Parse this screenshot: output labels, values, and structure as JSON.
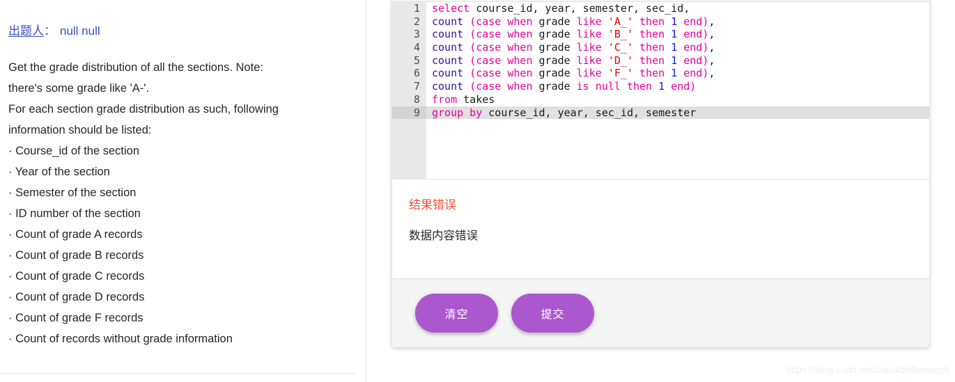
{
  "problem": {
    "author_label": "出题人",
    "author_colon": "：",
    "author_name": "null null",
    "description_lines": [
      "Get the grade distribution of all the sections. Note:",
      "there's some grade like 'A-'.",
      "For each section grade distribution as such, following",
      "information should be listed:"
    ],
    "requirements": [
      "· Course_id of the section",
      "· Year of the section",
      "· Semester of the section",
      "· ID number of the section",
      "· Count of grade A records",
      "· Count of grade B records",
      "· Count of grade C records",
      "· Count of grade D records",
      "· Count of grade F records",
      "· Count of records without grade information"
    ]
  },
  "editor": {
    "active_line": 9,
    "line_numbers": [
      "1",
      "2",
      "3",
      "4",
      "5",
      "6",
      "7",
      "8",
      "9"
    ],
    "lines": [
      [
        {
          "t": "select",
          "c": "kw"
        },
        {
          "t": " course_id, year, semester, sec_id,",
          "c": "pl"
        }
      ],
      [
        {
          "t": "count ",
          "c": "fn"
        },
        {
          "t": "(",
          "c": "kw"
        },
        {
          "t": "case when",
          "c": "kw"
        },
        {
          "t": " grade ",
          "c": "pl"
        },
        {
          "t": "like",
          "c": "kw"
        },
        {
          "t": " ",
          "c": "pl"
        },
        {
          "t": "'A_'",
          "c": "str"
        },
        {
          "t": " ",
          "c": "pl"
        },
        {
          "t": "then",
          "c": "kw"
        },
        {
          "t": " ",
          "c": "pl"
        },
        {
          "t": "1",
          "c": "num"
        },
        {
          "t": " ",
          "c": "pl"
        },
        {
          "t": "end",
          "c": "kw"
        },
        {
          "t": ")",
          "c": "kw"
        },
        {
          "t": ",",
          "c": "pl"
        }
      ],
      [
        {
          "t": "count ",
          "c": "fn"
        },
        {
          "t": "(",
          "c": "kw"
        },
        {
          "t": "case when",
          "c": "kw"
        },
        {
          "t": " grade ",
          "c": "pl"
        },
        {
          "t": "like",
          "c": "kw"
        },
        {
          "t": " ",
          "c": "pl"
        },
        {
          "t": "'B_'",
          "c": "str"
        },
        {
          "t": " ",
          "c": "pl"
        },
        {
          "t": "then",
          "c": "kw"
        },
        {
          "t": " ",
          "c": "pl"
        },
        {
          "t": "1",
          "c": "num"
        },
        {
          "t": " ",
          "c": "pl"
        },
        {
          "t": "end",
          "c": "kw"
        },
        {
          "t": ")",
          "c": "kw"
        },
        {
          "t": ",",
          "c": "pl"
        }
      ],
      [
        {
          "t": "count ",
          "c": "fn"
        },
        {
          "t": "(",
          "c": "kw"
        },
        {
          "t": "case when",
          "c": "kw"
        },
        {
          "t": " grade ",
          "c": "pl"
        },
        {
          "t": "like",
          "c": "kw"
        },
        {
          "t": " ",
          "c": "pl"
        },
        {
          "t": "'C_'",
          "c": "str"
        },
        {
          "t": " ",
          "c": "pl"
        },
        {
          "t": "then",
          "c": "kw"
        },
        {
          "t": " ",
          "c": "pl"
        },
        {
          "t": "1",
          "c": "num"
        },
        {
          "t": " ",
          "c": "pl"
        },
        {
          "t": "end",
          "c": "kw"
        },
        {
          "t": ")",
          "c": "kw"
        },
        {
          "t": ",",
          "c": "pl"
        }
      ],
      [
        {
          "t": "count ",
          "c": "fn"
        },
        {
          "t": "(",
          "c": "kw"
        },
        {
          "t": "case when",
          "c": "kw"
        },
        {
          "t": " grade ",
          "c": "pl"
        },
        {
          "t": "like",
          "c": "kw"
        },
        {
          "t": " ",
          "c": "pl"
        },
        {
          "t": "'D_'",
          "c": "str"
        },
        {
          "t": " ",
          "c": "pl"
        },
        {
          "t": "then",
          "c": "kw"
        },
        {
          "t": " ",
          "c": "pl"
        },
        {
          "t": "1",
          "c": "num"
        },
        {
          "t": " ",
          "c": "pl"
        },
        {
          "t": "end",
          "c": "kw"
        },
        {
          "t": ")",
          "c": "kw"
        },
        {
          "t": ",",
          "c": "pl"
        }
      ],
      [
        {
          "t": "count ",
          "c": "fn"
        },
        {
          "t": "(",
          "c": "kw"
        },
        {
          "t": "case when",
          "c": "kw"
        },
        {
          "t": " grade ",
          "c": "pl"
        },
        {
          "t": "like",
          "c": "kw"
        },
        {
          "t": " ",
          "c": "pl"
        },
        {
          "t": "'F_'",
          "c": "str"
        },
        {
          "t": " ",
          "c": "pl"
        },
        {
          "t": "then",
          "c": "kw"
        },
        {
          "t": " ",
          "c": "pl"
        },
        {
          "t": "1",
          "c": "num"
        },
        {
          "t": " ",
          "c": "pl"
        },
        {
          "t": "end",
          "c": "kw"
        },
        {
          "t": ")",
          "c": "kw"
        },
        {
          "t": ",",
          "c": "pl"
        }
      ],
      [
        {
          "t": "count ",
          "c": "fn"
        },
        {
          "t": "(",
          "c": "kw"
        },
        {
          "t": "case when",
          "c": "kw"
        },
        {
          "t": " grade ",
          "c": "pl"
        },
        {
          "t": "is null",
          "c": "kw"
        },
        {
          "t": " ",
          "c": "pl"
        },
        {
          "t": "then",
          "c": "kw"
        },
        {
          "t": " ",
          "c": "pl"
        },
        {
          "t": "1",
          "c": "num"
        },
        {
          "t": " ",
          "c": "pl"
        },
        {
          "t": "end",
          "c": "kw"
        },
        {
          "t": ")",
          "c": "kw"
        }
      ],
      [
        {
          "t": "from",
          "c": "kw"
        },
        {
          "t": " takes",
          "c": "pl"
        }
      ],
      [
        {
          "t": "group by",
          "c": "kw"
        },
        {
          "t": " course_id, year, sec_id, semester",
          "c": "pl"
        }
      ]
    ],
    "code_plain": "select course_id, year, semester, sec_id,\ncount (case when grade like 'A_' then 1 end),\ncount (case when grade like 'B_' then 1 end),\ncount (case when grade like 'C_' then 1 end),\ncount (case when grade like 'D_' then 1 end),\ncount (case when grade like 'F_' then 1 end),\ncount (case when grade is null then 1 end)\nfrom takes\ngroup by course_id, year, sec_id, semester"
  },
  "result": {
    "title": "结果错误",
    "message": "数据内容错误",
    "title_color": "#f4503a"
  },
  "footer": {
    "clear_label": "清空",
    "submit_label": "提交",
    "button_color": "#ab57ce"
  },
  "watermark": {
    "text": "https://blog.csdn.net/zlasjkbhfkawejgh"
  }
}
